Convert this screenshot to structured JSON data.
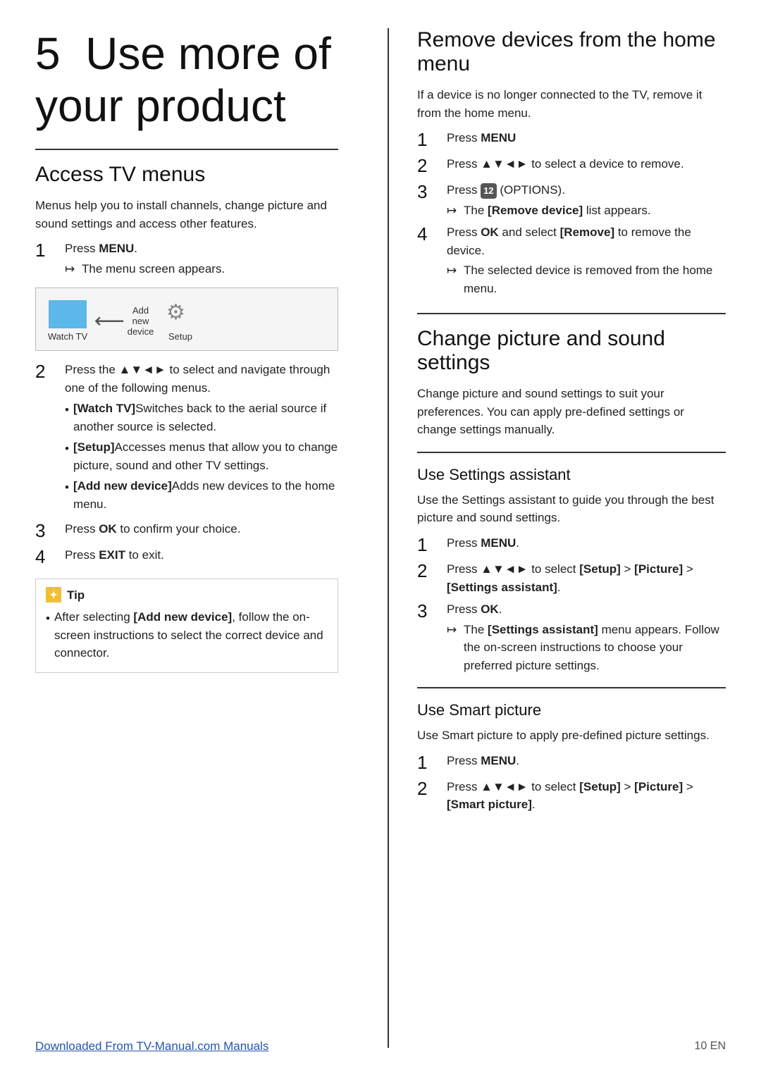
{
  "page": {
    "chapter_num": "5",
    "chapter_title": "Use more of\nyour product",
    "footer_link": "Downloaded From TV-Manual.com Manuals",
    "footer_page": "10 EN"
  },
  "left": {
    "section_title": "Access TV menus",
    "intro": "Menus help you to install channels, change picture and sound settings and access other features.",
    "steps": [
      {
        "num": "1",
        "text": "Press MENU.",
        "result": "The menu screen appears."
      },
      {
        "num": "2",
        "text": "Press the ▲▼◄► to select and navigate through one of the following menus."
      },
      {
        "num": "3",
        "text": "Press OK to confirm your choice."
      },
      {
        "num": "4",
        "text": "Press EXIT to exit."
      }
    ],
    "menu_items": [
      {
        "label": "Watch TV",
        "type": "watch"
      },
      {
        "label": "Add new device",
        "type": "add"
      },
      {
        "label": "Setup",
        "type": "setup"
      }
    ],
    "bullet_items": [
      {
        "key": "[Watch TV]",
        "text": "Switches back to the aerial source if another source is selected."
      },
      {
        "key": "[Setup]",
        "text": "Accesses menus that allow you to change picture, sound and other TV settings."
      },
      {
        "key": "[Add new device]",
        "text": "Adds new devices to the home menu."
      }
    ],
    "tip_header": "Tip",
    "tip_text": "After selecting [Add new device], follow the on-screen instructions to select the correct device and connector."
  },
  "right": {
    "section1": {
      "title": "Remove devices from the home menu",
      "intro": "If a device is no longer connected to the TV, remove it from the home menu.",
      "steps": [
        {
          "num": "1",
          "text": "Press MENU"
        },
        {
          "num": "2",
          "text": "Press ▲▼◄► to select a device to remove."
        },
        {
          "num": "3",
          "text": "Press  (OPTIONS).",
          "options_badge": "12",
          "result": "The [Remove device] list appears."
        },
        {
          "num": "4",
          "text": "Press OK and select [Remove] to remove the device.",
          "result": "The selected device is removed from the home menu."
        }
      ]
    },
    "section2": {
      "title": "Change picture and sound settings",
      "intro": "Change picture and sound settings to suit your preferences. You can apply pre-defined settings or change settings manually.",
      "subsections": [
        {
          "title": "Use Settings assistant",
          "intro": "Use the Settings assistant to guide you through the best picture and sound settings.",
          "steps": [
            {
              "num": "1",
              "text": "Press MENU."
            },
            {
              "num": "2",
              "text": "Press ▲▼◄► to select [Setup] > [Picture] > [Settings assistant]."
            },
            {
              "num": "3",
              "text": "Press OK.",
              "result": "The [Settings assistant] menu appears. Follow the on-screen instructions to choose your preferred picture settings."
            }
          ]
        },
        {
          "title": "Use Smart picture",
          "intro": "Use Smart picture to apply pre-defined picture settings.",
          "steps": [
            {
              "num": "1",
              "text": "Press MENU."
            },
            {
              "num": "2",
              "text": "Press ▲▼◄► to select [Setup] > [Picture] > [Smart picture]."
            }
          ]
        }
      ]
    }
  }
}
